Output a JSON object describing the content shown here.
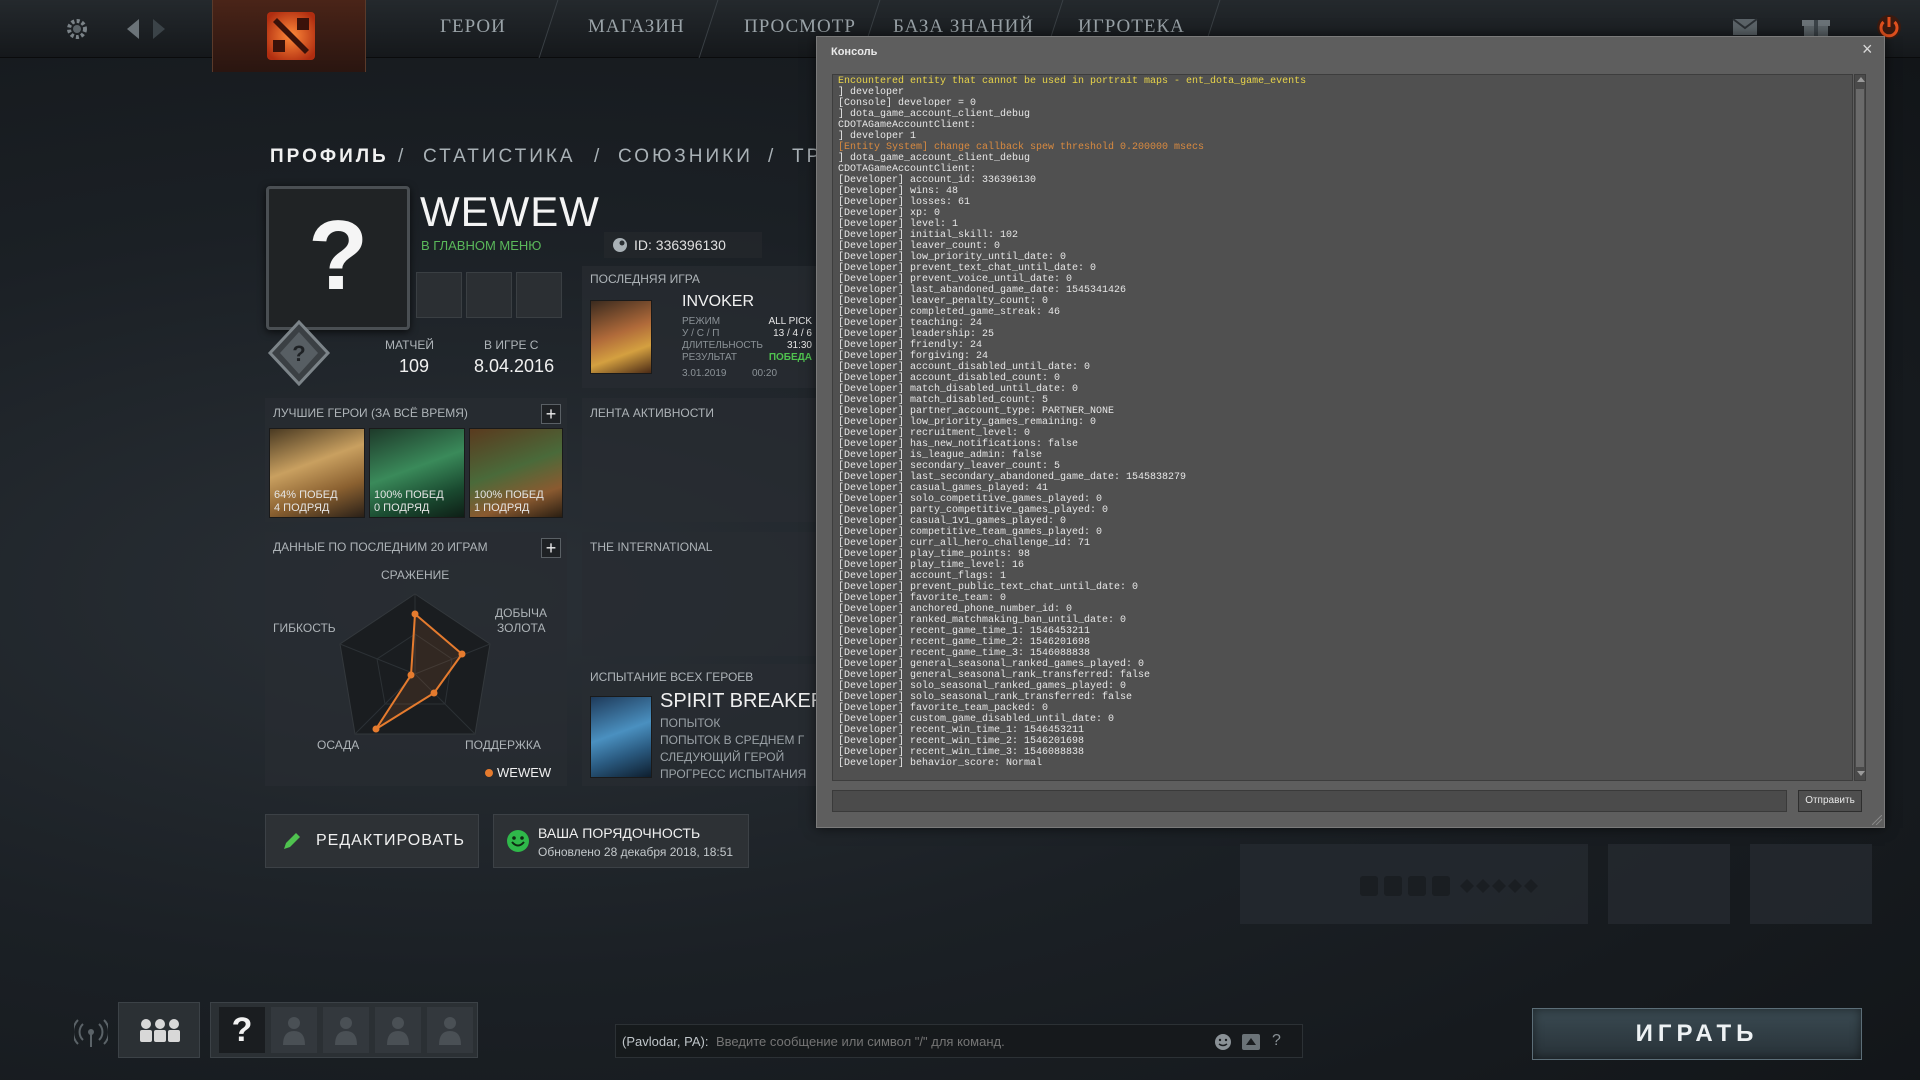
{
  "topnav": {
    "items": [
      "ГЕРОИ",
      "МАГАЗИН",
      "ПРОСМОТР",
      "БАЗА ЗНАНИЙ",
      "ИГРОТЕКА"
    ]
  },
  "profile": {
    "breadcrumbs": [
      "ПРОФИЛЬ",
      "/",
      "СТАТИСТИКА",
      "/",
      "СОЮЗНИКИ",
      "/",
      "ТР"
    ],
    "avatar_symbol": "?",
    "name": "WEWEW",
    "status": "В ГЛАВНОМ МЕНЮ",
    "id_label": "ID: 336396130",
    "matches_label": "МАТЧЕЙ",
    "matches_value": "109",
    "ingame_label": "В ИГРЕ С",
    "ingame_value": "8.04.2016",
    "last_game": {
      "header": "ПОСЛЕДНЯЯ ИГРА",
      "hero": "INVOKER",
      "mode_label": "РЕЖИМ",
      "mode_value": "ALL PICK",
      "kda_label": "У / С / П",
      "kda_value": "13 / 4 / 6",
      "duration_label": "ДЛИТЕЛЬНОСТЬ",
      "duration_value": "31:30",
      "result_label": "РЕЗУЛЬТАТ",
      "result_value": "ПОБЕДА",
      "date": "3.01.2019",
      "time": "00:20"
    },
    "best_heroes": {
      "header": "ЛУЧШИЕ ГЕРОИ (ЗА ВСЁ ВРЕМЯ)",
      "plus": "+",
      "items": [
        {
          "win": "64% ПОБЕД",
          "streak": "4 ПОДРЯД"
        },
        {
          "win": "100% ПОБЕД",
          "streak": "0 ПОДРЯД"
        },
        {
          "win": "100% ПОБЕД",
          "streak": "1 ПОДРЯД"
        }
      ]
    },
    "activity_header": "ЛЕНТА АКТИВНОСТИ",
    "ti_header": "THE INTERNATIONAL",
    "last20": {
      "header": "ДАННЫЕ ПО ПОСЛЕДНИМ 20 ИГРАМ",
      "plus": "+",
      "axes": {
        "fight": "СРАЖЕНИЕ",
        "farm1": "ДОБЫЧА",
        "farm2": "ЗОЛОТА",
        "support": "ПОДДЕРЖКА",
        "push": "ОСАДА",
        "versatility": "ГИБКОСТЬ"
      },
      "legend": "WEWEW"
    },
    "challenge": {
      "header": "ИСПЫТАНИЕ ВСЕХ ГЕРОЕВ",
      "hero": "SPIRIT BREAKER",
      "lines": [
        "ПОПЫТОК",
        "ПОПЫТОК В СРЕДНЕМ Г",
        "СЛЕДУЮЩИЙ ГЕРОЙ",
        "ПРОГРЕСС ИСПЫТАНИЯ"
      ]
    },
    "edit_button": "РЕДАКТИРОВАТЬ",
    "conduct": {
      "title": "ВАША ПОРЯДОЧНОСТЬ",
      "updated": "Обновлено 28 декабря 2018, 18:51"
    }
  },
  "console": {
    "title": "Консоль",
    "close": "×",
    "send_button": "Отправить",
    "input_value": "",
    "lines": [
      {
        "t": "Encountered entity that cannot be used in portrait maps - ent_dota_game_events",
        "c": "y"
      },
      {
        "t": "] developer",
        "c": ""
      },
      {
        "t": "[Console] developer = 0",
        "c": ""
      },
      {
        "t": "] dota_game_account_client_debug",
        "c": ""
      },
      {
        "t": "CDOTAGameAccountClient:",
        "c": ""
      },
      {
        "t": "] developer 1",
        "c": ""
      },
      {
        "t": "[Entity System] change callback spew threshold 0.200000 msecs",
        "c": "o"
      },
      {
        "t": "] dota_game_account_client_debug",
        "c": ""
      },
      {
        "t": "CDOTAGameAccountClient:",
        "c": ""
      },
      {
        "t": "[Developer] account_id: 336396130",
        "c": ""
      },
      {
        "t": "[Developer] wins: 48",
        "c": ""
      },
      {
        "t": "[Developer] losses: 61",
        "c": ""
      },
      {
        "t": "[Developer] xp: 0",
        "c": ""
      },
      {
        "t": "[Developer] level: 1",
        "c": ""
      },
      {
        "t": "[Developer] initial_skill: 102",
        "c": ""
      },
      {
        "t": "[Developer] leaver_count: 0",
        "c": ""
      },
      {
        "t": "[Developer] low_priority_until_date: 0",
        "c": ""
      },
      {
        "t": "[Developer] prevent_text_chat_until_date: 0",
        "c": ""
      },
      {
        "t": "[Developer] prevent_voice_until_date: 0",
        "c": ""
      },
      {
        "t": "[Developer] last_abandoned_game_date: 1545341426",
        "c": ""
      },
      {
        "t": "[Developer] leaver_penalty_count: 0",
        "c": ""
      },
      {
        "t": "[Developer] completed_game_streak: 46",
        "c": ""
      },
      {
        "t": "[Developer] teaching: 24",
        "c": ""
      },
      {
        "t": "[Developer] leadership: 25",
        "c": ""
      },
      {
        "t": "[Developer] friendly: 24",
        "c": ""
      },
      {
        "t": "[Developer] forgiving: 24",
        "c": ""
      },
      {
        "t": "[Developer] account_disabled_until_date: 0",
        "c": ""
      },
      {
        "t": "[Developer] account_disabled_count: 0",
        "c": ""
      },
      {
        "t": "[Developer] match_disabled_until_date: 0",
        "c": ""
      },
      {
        "t": "[Developer] match_disabled_count: 5",
        "c": ""
      },
      {
        "t": "[Developer] partner_account_type: PARTNER_NONE",
        "c": ""
      },
      {
        "t": "[Developer] low_priority_games_remaining: 0",
        "c": ""
      },
      {
        "t": "[Developer] recruitment_level: 0",
        "c": ""
      },
      {
        "t": "[Developer] has_new_notifications: false",
        "c": ""
      },
      {
        "t": "[Developer] is_league_admin: false",
        "c": ""
      },
      {
        "t": "[Developer] secondary_leaver_count: 5",
        "c": ""
      },
      {
        "t": "[Developer] last_secondary_abandoned_game_date: 1545838279",
        "c": ""
      },
      {
        "t": "[Developer] casual_games_played: 41",
        "c": ""
      },
      {
        "t": "[Developer] solo_competitive_games_played: 0",
        "c": ""
      },
      {
        "t": "[Developer] party_competitive_games_played: 0",
        "c": ""
      },
      {
        "t": "[Developer] casual_1v1_games_played: 0",
        "c": ""
      },
      {
        "t": "[Developer] competitive_team_games_played: 0",
        "c": ""
      },
      {
        "t": "[Developer] curr_all_hero_challenge_id: 71",
        "c": ""
      },
      {
        "t": "[Developer] play_time_points: 98",
        "c": ""
      },
      {
        "t": "[Developer] play_time_level: 16",
        "c": ""
      },
      {
        "t": "[Developer] account_flags: 1",
        "c": ""
      },
      {
        "t": "[Developer] prevent_public_text_chat_until_date: 0",
        "c": ""
      },
      {
        "t": "[Developer] favorite_team: 0",
        "c": ""
      },
      {
        "t": "[Developer] anchored_phone_number_id: 0",
        "c": ""
      },
      {
        "t": "[Developer] ranked_matchmaking_ban_until_date: 0",
        "c": ""
      },
      {
        "t": "[Developer] recent_game_time_1: 1546453211",
        "c": ""
      },
      {
        "t": "[Developer] recent_game_time_2: 1546201698",
        "c": ""
      },
      {
        "t": "[Developer] recent_game_time_3: 1546088838",
        "c": ""
      },
      {
        "t": "[Developer] general_seasonal_ranked_games_played: 0",
        "c": ""
      },
      {
        "t": "[Developer] general_seasonal_rank_transferred: false",
        "c": ""
      },
      {
        "t": "[Developer] solo_seasonal_ranked_games_played: 0",
        "c": ""
      },
      {
        "t": "[Developer] solo_seasonal_rank_transferred: false",
        "c": ""
      },
      {
        "t": "[Developer] favorite_team_packed: 0",
        "c": ""
      },
      {
        "t": "[Developer] custom_game_disabled_until_date: 0",
        "c": ""
      },
      {
        "t": "[Developer] recent_win_time_1: 1546453211",
        "c": ""
      },
      {
        "t": "[Developer] recent_win_time_2: 1546201698",
        "c": ""
      },
      {
        "t": "[Developer] recent_win_time_3: 1546088838",
        "c": ""
      },
      {
        "t": "[Developer] behavior_score: Normal",
        "c": ""
      }
    ]
  },
  "chat": {
    "prefix": "(Pavlodar, PA):",
    "placeholder": "Введите сообщение или символ \"/\" для команд.",
    "help": "?"
  },
  "party": {
    "help": "?"
  },
  "play_button": "ИГРАТЬ",
  "colors": {
    "accent": "#e57b2e",
    "win": "#4fc24f",
    "status": "#5ab85a",
    "console_yellow": "#e8d44a",
    "console_orange": "#d98a40"
  }
}
